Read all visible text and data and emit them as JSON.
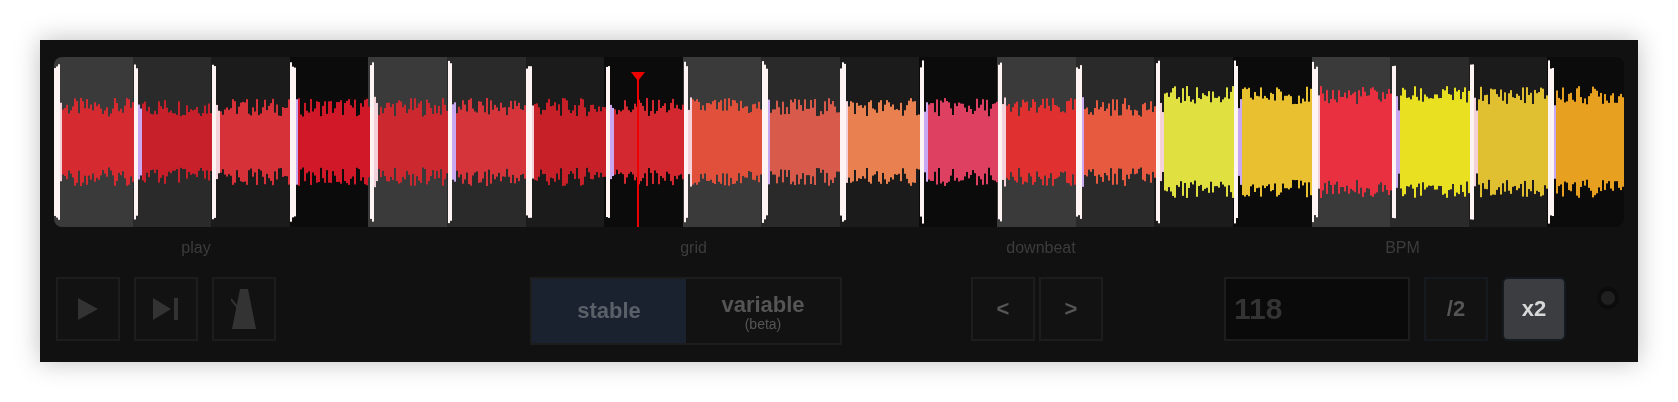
{
  "play": {
    "label": "play"
  },
  "grid": {
    "label": "grid",
    "options": [
      {
        "label": "stable",
        "selected": true
      },
      {
        "label": "variable",
        "note": "(beta)",
        "selected": false
      }
    ]
  },
  "downbeat": {
    "label": "downbeat",
    "buttons": [
      "<",
      ">"
    ]
  },
  "bpm": {
    "label": "BPM",
    "value": "118",
    "multipliers": [
      {
        "label": "/2",
        "selected": false
      },
      {
        "label": "x2",
        "selected": true
      }
    ]
  }
}
